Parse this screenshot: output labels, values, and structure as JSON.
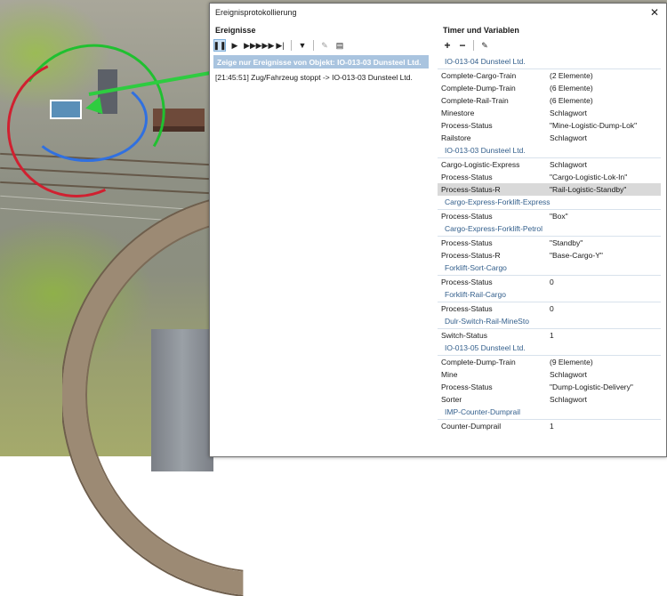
{
  "window": {
    "title": "Ereignisprotokollierung",
    "close_glyph": "✕"
  },
  "events": {
    "header": "Ereignisse",
    "toolbar": [
      "pause-icon",
      "play-icon",
      "step-icon",
      "fast-forward-icon",
      "skip-end-icon",
      "filter-icon",
      "edit-icon",
      "clear-filter-icon"
    ],
    "filter_text": "Zeige nur Ereignisse von Objekt: IO-013-03 Dunsteel Ltd.",
    "entries": [
      "[21:45:51] Zug/Fahrzeug stoppt -> IO-013-03 Dunsteel Ltd."
    ]
  },
  "timers": {
    "header": "Timer und Variablen",
    "toolbar": [
      "add-icon",
      "remove-icon",
      "edit-icon"
    ],
    "groups": [
      {
        "name": "IO-013-04 Dunsteel Ltd.",
        "rows": [
          [
            "Complete-Cargo-Train",
            "(2 Elemente)"
          ],
          [
            "Complete-Dump-Train",
            "(6 Elemente)"
          ],
          [
            "Complete-Rail-Train",
            "(6 Elemente)"
          ],
          [
            "Minestore",
            "Schlagwort"
          ],
          [
            "Process-Status",
            "\"Mine-Logistic-Dump-Lok\""
          ],
          [
            "Railstore",
            "Schlagwort"
          ]
        ]
      },
      {
        "name": "IO-013-03 Dunsteel Ltd.",
        "rows": [
          [
            "Cargo-Logistic-Express",
            "Schlagwort"
          ],
          [
            "Process-Status",
            "\"Cargo-Logistic-Lok-In\""
          ],
          [
            "Process-Status-R",
            "\"Rail-Logistic-Standby\""
          ]
        ]
      },
      {
        "name": "Cargo-Express-Forklift-Express",
        "rows": [
          [
            "Process-Status",
            "\"Box\""
          ]
        ]
      },
      {
        "name": "Cargo-Express-Forklift-Petrol",
        "rows": [
          [
            "Process-Status",
            "\"Standby\""
          ],
          [
            "Process-Status-R",
            "\"Base-Cargo-Y\""
          ]
        ]
      },
      {
        "name": "Forklift-Sort-Cargo",
        "rows": [
          [
            "Process-Status",
            "0"
          ]
        ]
      },
      {
        "name": "Forklift-Rail-Cargo",
        "rows": [
          [
            "Process-Status",
            "0"
          ]
        ]
      },
      {
        "name": "Dulr-Switch-Rail-MineSto",
        "rows": [
          [
            "Switch-Status",
            "1"
          ]
        ]
      },
      {
        "name": "IO-013-05 Dunsteel Ltd.",
        "rows": [
          [
            "Complete-Dump-Train",
            "(9 Elemente)"
          ],
          [
            "Mine",
            "Schlagwort"
          ],
          [
            "Process-Status",
            "\"Dump-Logistic-Delivery\""
          ],
          [
            "Sorter",
            "Schlagwort"
          ]
        ]
      },
      {
        "name": "IMP-Counter-Dumprail",
        "rows": [
          [
            "Counter-Dumprail",
            "1"
          ]
        ]
      }
    ],
    "selected": {
      "group": 1,
      "row": 2
    }
  },
  "colors": {
    "group_header": "#335f8c",
    "filter_bar": "#a9c4df",
    "selected_row": "#d9d9d9",
    "gizmo_red": "#d02030",
    "gizmo_blue": "#3070e0",
    "gizmo_green": "#20c030"
  }
}
